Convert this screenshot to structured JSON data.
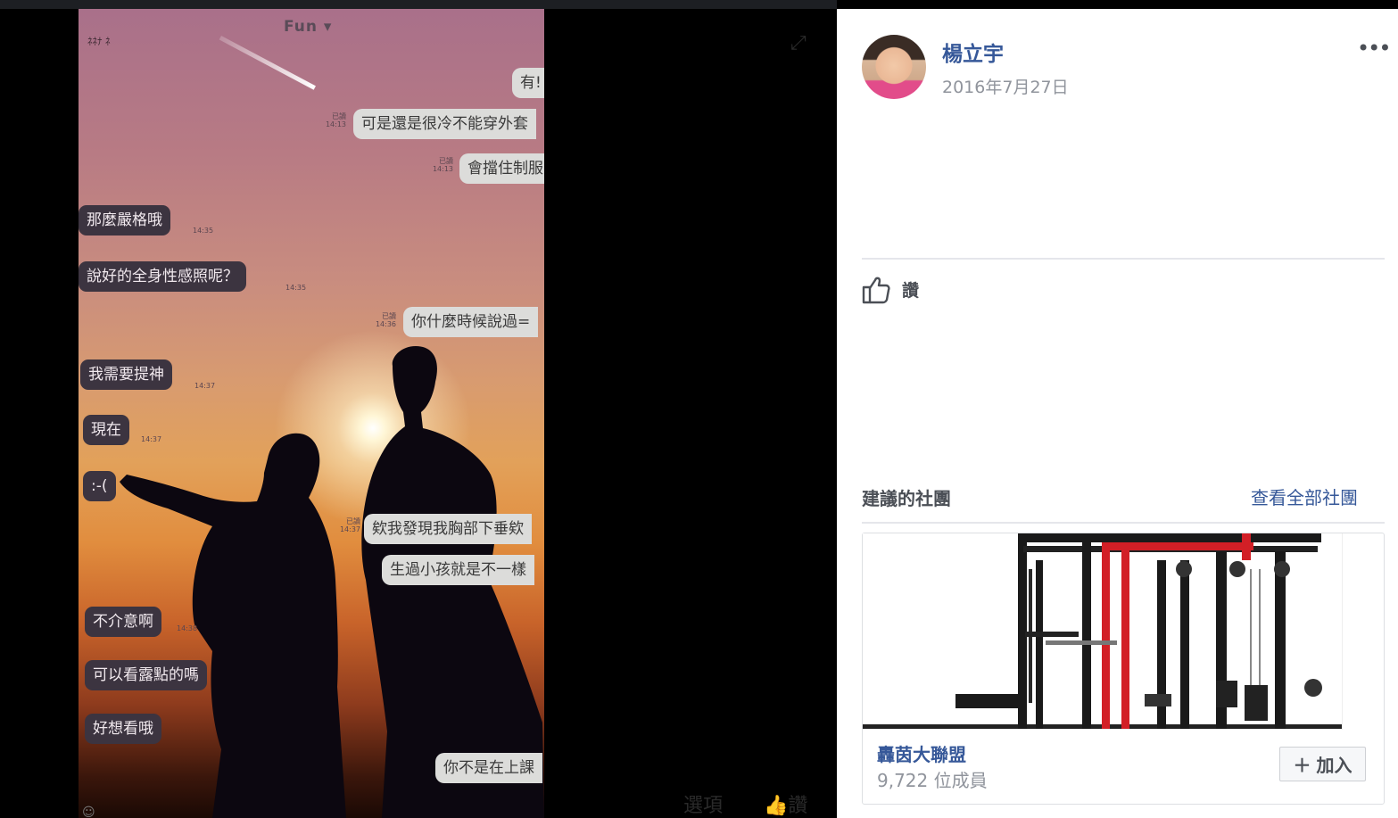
{
  "photo": {
    "chat_title": "Fun ▾",
    "status_text": "ﾈﾈﾅ ﾈ",
    "messages": [
      {
        "side": "out",
        "text": "有!"
      },
      {
        "side": "out",
        "text": "可是還是很冷不能穿外套",
        "read": "已讀",
        "time": "14:13"
      },
      {
        "side": "out",
        "text": "會擋住制服",
        "read": "已讀",
        "time": "14:13"
      },
      {
        "side": "in",
        "text": "那麼嚴格哦",
        "time": "14:35"
      },
      {
        "side": "in",
        "text": "說好的全身性感照呢？",
        "time": "14:35"
      },
      {
        "side": "out",
        "text": "你什麼時候說過=",
        "read": "已讀",
        "time": "14:36"
      },
      {
        "side": "in",
        "text": "我需要提神",
        "time": "14:37"
      },
      {
        "side": "in",
        "text": "現在",
        "time": "14:37"
      },
      {
        "side": "in",
        "text": ":-("
      },
      {
        "side": "out",
        "text": "欸我發現我胸部下垂欸",
        "read": "已讀",
        "time": "14:37"
      },
      {
        "side": "out",
        "text": "生過小孩就是不一樣"
      },
      {
        "side": "in",
        "text": "不介意啊",
        "time": "14:38"
      },
      {
        "side": "in",
        "text": "可以看露點的嗎"
      },
      {
        "side": "in",
        "text": "好想看哦"
      },
      {
        "side": "out",
        "text": "你不是在上課"
      }
    ]
  },
  "viewer": {
    "options_label": "選項",
    "like_label": "讚"
  },
  "post": {
    "author": "楊立宇",
    "date": "2016年7月27日",
    "more_label": "•••",
    "like_label": "讚"
  },
  "suggested_groups": {
    "title": "建議的社團",
    "see_all": "查看全部社團",
    "group": {
      "name": "轟茵大聯盟",
      "members": "9,722 位成員",
      "join_label": "加入"
    }
  },
  "colors": {
    "link": "#365899",
    "secondary_text": "#90949c",
    "divider": "#e5e6eb",
    "accent_red": "#d21f26"
  }
}
